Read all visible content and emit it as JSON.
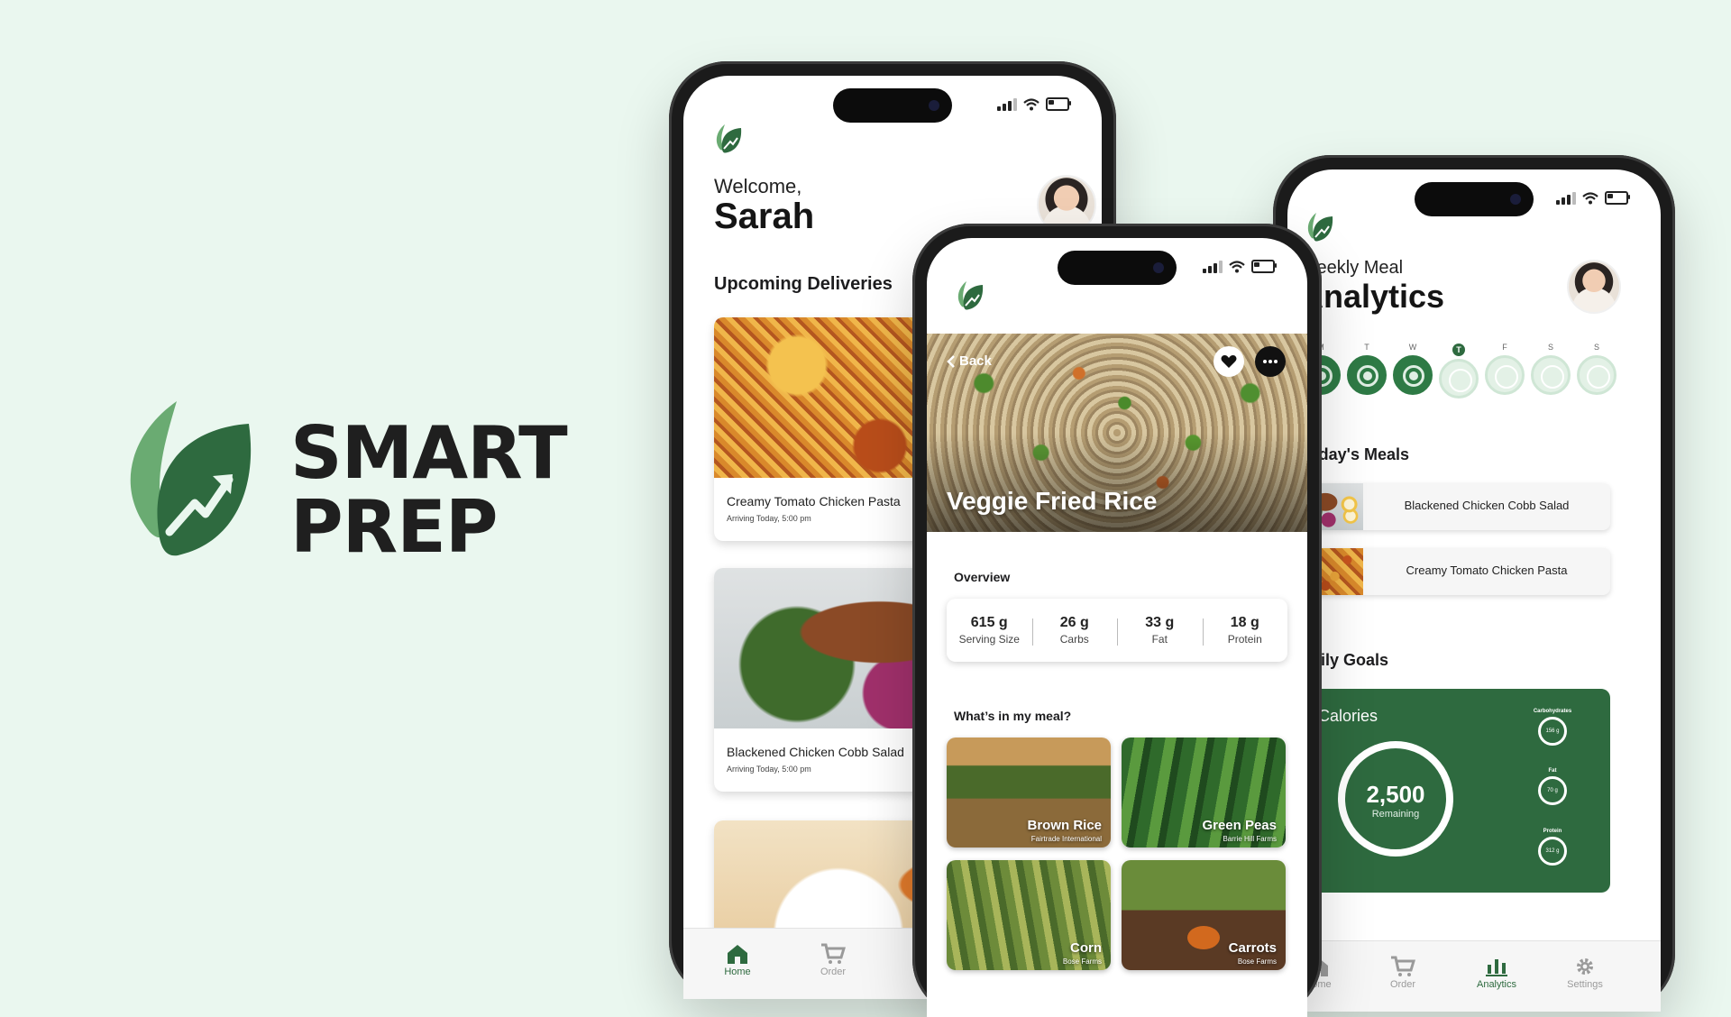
{
  "brand": {
    "line1": "SMART",
    "line2": "PREP",
    "primary_color": "#2e6a3f",
    "secondary_color": "#6aab72"
  },
  "home": {
    "welcome": "Welcome,",
    "name": "Sarah",
    "section_title": "Upcoming Deliveries",
    "deliveries": [
      {
        "title": "Creamy Tomato Chicken Pasta",
        "subtitle": "Arriving Today, 5:00 pm"
      },
      {
        "title": "Blackened Chicken Cobb Salad",
        "subtitle": "Arriving Today, 5:00 pm"
      }
    ],
    "tabs": [
      {
        "label": "Home",
        "icon": "home-icon"
      },
      {
        "label": "Order",
        "icon": "cart-icon"
      }
    ]
  },
  "detail": {
    "back_label": "Back",
    "title": "Veggie Fried Rice",
    "overview_title": "Overview",
    "stats": [
      {
        "value": "615 g",
        "label": "Serving Size"
      },
      {
        "value": "26 g",
        "label": "Carbs"
      },
      {
        "value": "33 g",
        "label": "Fat"
      },
      {
        "value": "18 g",
        "label": "Protein"
      }
    ],
    "ingredients_title": "What’s in my meal?",
    "ingredients": [
      {
        "name": "Brown Rice",
        "source": "Fairtrade International"
      },
      {
        "name": "Green Peas",
        "source": "Barrie Hill Farms"
      },
      {
        "name": "Corn",
        "source": "Bose Farms"
      },
      {
        "name": "Carrots",
        "source": "Bose Farms"
      }
    ]
  },
  "analytics": {
    "subtitle": "Weekly Meal",
    "title": "Analytics",
    "days": [
      {
        "label": "M",
        "status": "complete"
      },
      {
        "label": "T",
        "status": "complete"
      },
      {
        "label": "W",
        "status": "complete"
      },
      {
        "label": "T",
        "status": "today"
      },
      {
        "label": "F",
        "status": "upcoming"
      },
      {
        "label": "S",
        "status": "upcoming"
      },
      {
        "label": "S",
        "status": "upcoming"
      }
    ],
    "todays_meals_title": "Today's Meals",
    "todays_meals": [
      "Blackened Chicken Cobb Salad",
      "Creamy Tomato Chicken Pasta"
    ],
    "daily_goals_title": "Daily Goals",
    "calories_label": "Calories",
    "calories_value": "2,500",
    "calories_caption": "Remaining",
    "macros": [
      {
        "label": "Carbohydrates",
        "value": "156 g"
      },
      {
        "label": "Fat",
        "value": "70 g"
      },
      {
        "label": "Protein",
        "value": "312 g"
      }
    ],
    "tabs": [
      {
        "label": "Home",
        "icon": "home-icon"
      },
      {
        "label": "Order",
        "icon": "cart-icon"
      },
      {
        "label": "Analytics",
        "icon": "bar-chart-icon"
      },
      {
        "label": "Settings",
        "icon": "gear-icon"
      }
    ]
  }
}
